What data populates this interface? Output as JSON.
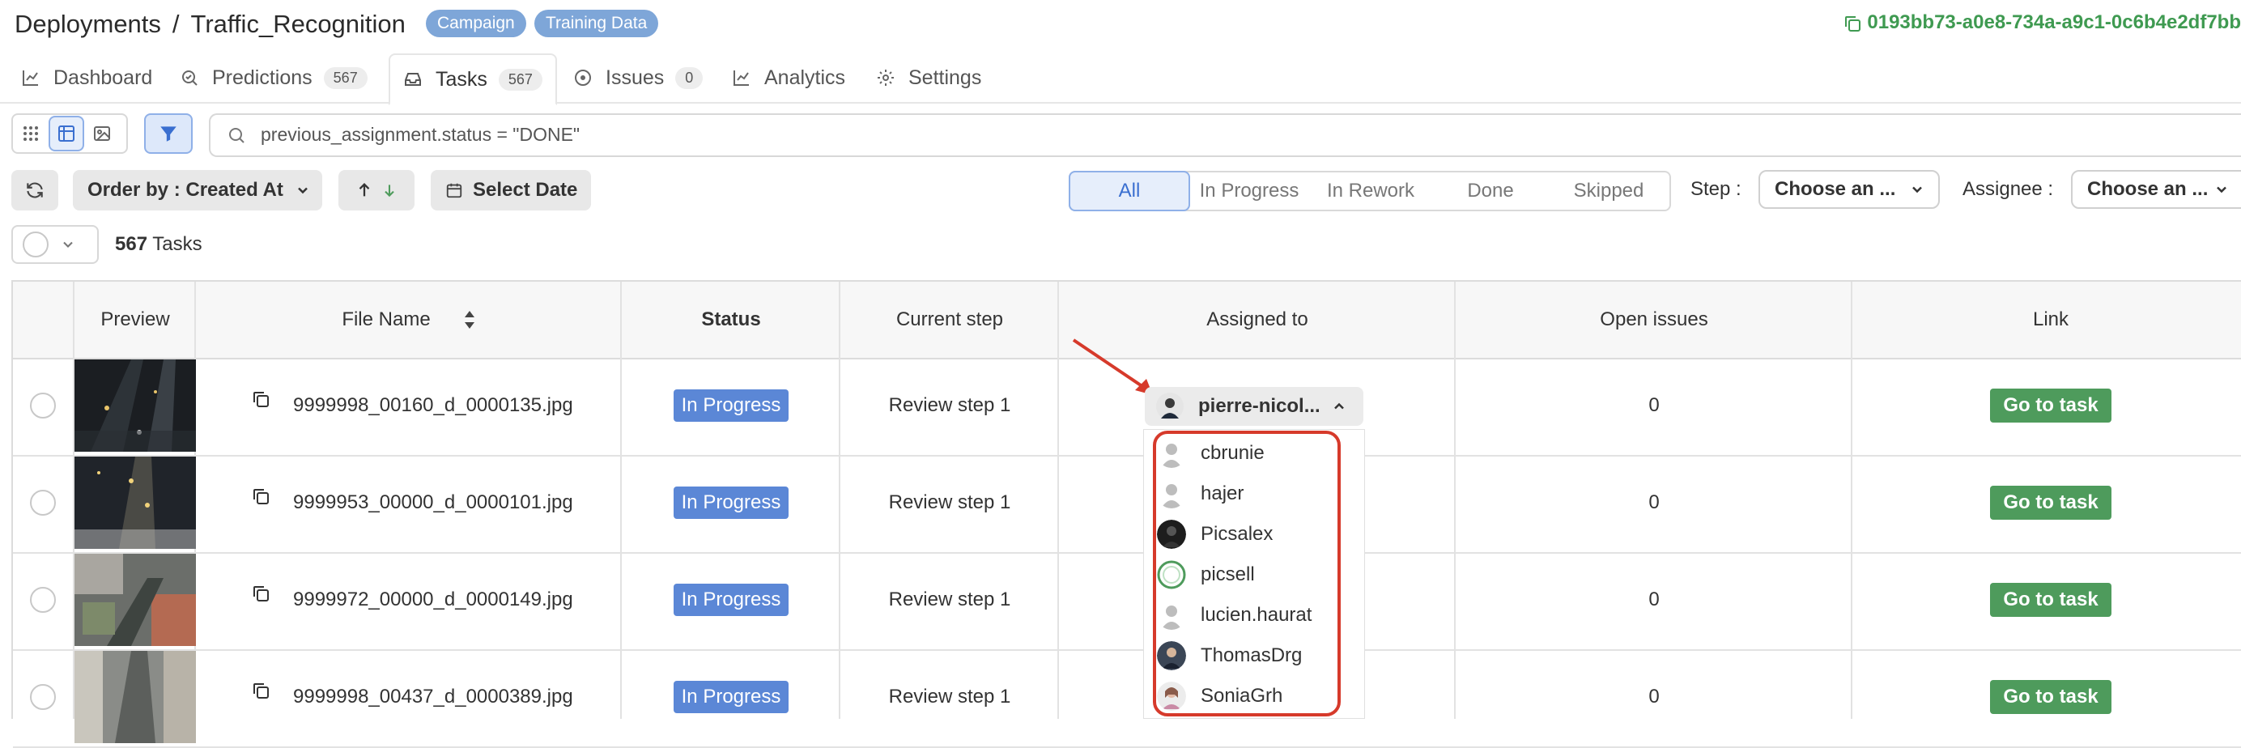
{
  "header": {
    "breadcrumb_root": "Deployments",
    "breadcrumb_sep": "/",
    "deployment_name": "Traffic_Recognition",
    "badges": [
      {
        "label": "Campaign",
        "color": "#7ea6d8"
      },
      {
        "label": "Training Data",
        "color": "#7ea6d8"
      }
    ],
    "uuid": "0193bb73-a0e8-734a-a9c1-0c6b4e2df7bb"
  },
  "tabs": [
    {
      "label": "Dashboard",
      "icon": "line-chart-icon"
    },
    {
      "label": "Predictions",
      "icon": "search-check-icon",
      "count": "567"
    },
    {
      "label": "Tasks",
      "icon": "inbox-icon",
      "count": "567",
      "active": true
    },
    {
      "label": "Issues",
      "icon": "alert-circle-icon",
      "count": "0"
    },
    {
      "label": "Analytics",
      "icon": "line-chart-icon"
    },
    {
      "label": "Settings",
      "icon": "gear-icon"
    }
  ],
  "search": {
    "query": "previous_assignment.status = \"DONE\""
  },
  "toolbar": {
    "order_by": "Order by : Created At",
    "select_date": "Select Date"
  },
  "status_filter": [
    "All",
    "In Progress",
    "In Rework",
    "Done",
    "Skipped"
  ],
  "step_filter": {
    "label": "Step :",
    "value": "Choose an ..."
  },
  "assignee_filter": {
    "label": "Assignee :",
    "value": "Choose an ..."
  },
  "task_count": {
    "number": "567",
    "label": "Tasks"
  },
  "table": {
    "headers": [
      "Preview",
      "File Name",
      "Status",
      "Current step",
      "Assigned to",
      "Open issues",
      "Link"
    ],
    "rows": [
      {
        "file": "9999998_00160_d_0000135.jpg",
        "status": "In Progress",
        "step": "Review step 1",
        "assignee": "pierre-nicol...",
        "issues": "0",
        "link": "Go to task"
      },
      {
        "file": "9999953_00000_d_0000101.jpg",
        "status": "In Progress",
        "step": "Review step 1",
        "assignee": "",
        "issues": "0",
        "link": "Go to task"
      },
      {
        "file": "9999972_00000_d_0000149.jpg",
        "status": "In Progress",
        "step": "Review step 1",
        "assignee": "",
        "issues": "0",
        "link": "Go to task"
      },
      {
        "file": "9999998_00437_d_0000389.jpg",
        "status": "In Progress",
        "step": "Review step 1",
        "assignee": "",
        "issues": "0",
        "link": "Go to task"
      }
    ]
  },
  "assignee_dropdown": {
    "options": [
      "cbrunie",
      "hajer",
      "Picsalex",
      "picsell",
      "lucien.haurat",
      "ThomasDrg",
      "SoniaGrh"
    ]
  },
  "colors": {
    "accent": "#3a6fd0",
    "status_in_progress": "#5b87d6",
    "go_button": "#4e9b5c",
    "annotation_red": "#d63a2b",
    "uuid_green": "#3f9a51"
  }
}
